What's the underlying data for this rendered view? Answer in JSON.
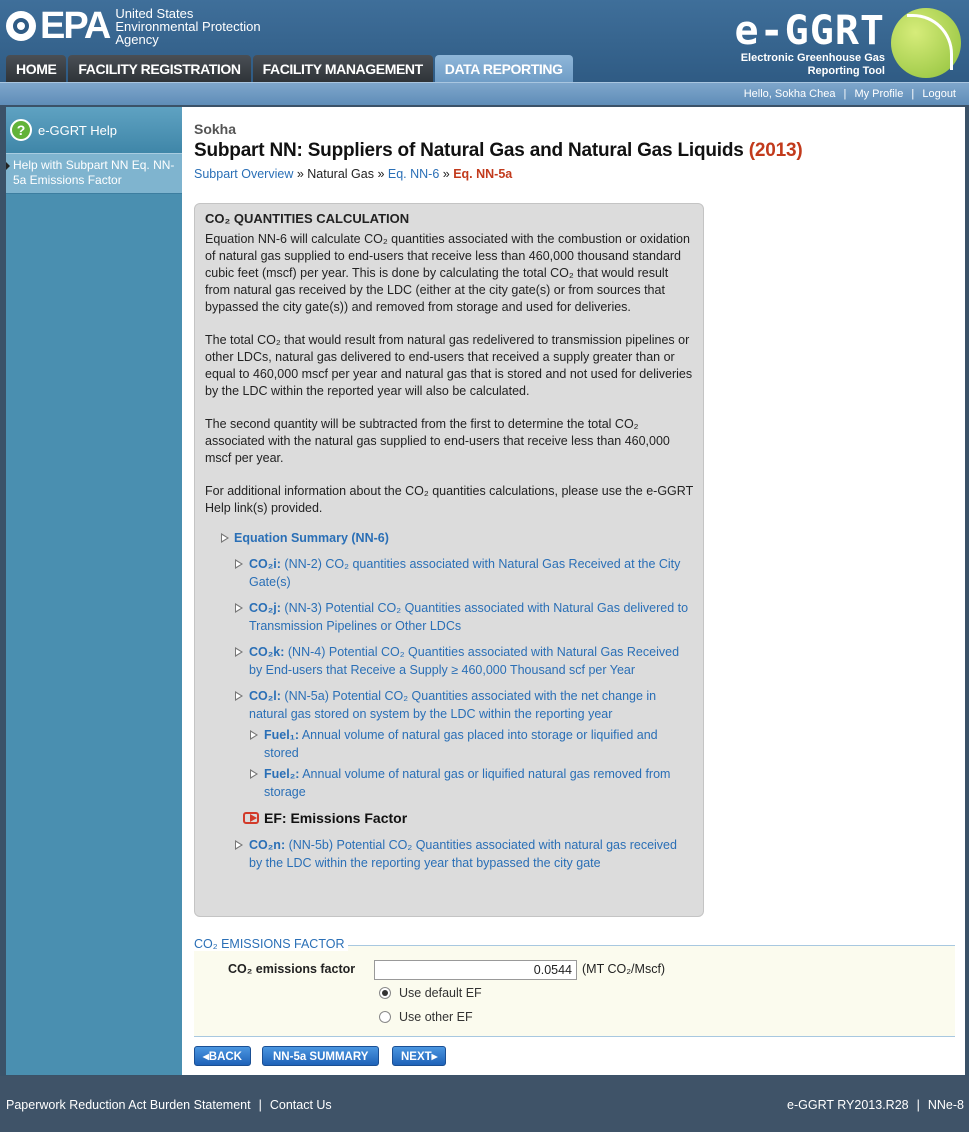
{
  "header": {
    "epa_word": "EPA",
    "epa_agency_line1": "United States",
    "epa_agency_line2": "Environmental Protection",
    "epa_agency_line3": "Agency",
    "ggrt_title": "e-GGRT",
    "ggrt_sub_line1": "Electronic Greenhouse Gas",
    "ggrt_sub_line2": "Reporting Tool"
  },
  "tabs": [
    {
      "label": "HOME"
    },
    {
      "label": "FACILITY REGISTRATION"
    },
    {
      "label": "FACILITY MANAGEMENT"
    },
    {
      "label": "DATA REPORTING"
    }
  ],
  "userbar": {
    "greeting": "Hello, Sokha Chea",
    "profile": "My Profile",
    "logout": "Logout",
    "sep": "|"
  },
  "leftnav": {
    "help_title": "e-GGRT Help",
    "help_icon": "?",
    "items": [
      {
        "label": "Help with Subpart NN Eq. NN-5a Emissions Factor"
      }
    ]
  },
  "main": {
    "org": "Sokha",
    "title": "Subpart NN: Suppliers of Natural Gas and Natural Gas Liquids",
    "year": "(2013)",
    "breadcrumb": {
      "overview": "Subpart Overview",
      "sep1": " » ",
      "natural_gas": "Natural Gas",
      "sep2": " » ",
      "eq_nn6": "Eq. NN-6",
      "sep3": " » ",
      "eq_nn5a": "Eq. NN-5a"
    },
    "calc": {
      "title": "CO₂ QUANTITIES CALCULATION",
      "paragraphs": [
        "Equation NN-6 will calculate CO₂ quantities associated with the combustion or oxidation of natural gas supplied to end-users that receive less than 460,000 thousand standard cubic feet (mscf) per year. This is done by calculating the total CO₂ that would result from natural gas received by the LDC (either at the city gate(s) or from sources that bypassed the city gate(s)) and removed from storage and used for deliveries.",
        "The total CO₂ that would result from natural gas redelivered to transmission pipelines or other LDCs, natural gas delivered to end-users that received a supply greater than or equal to 460,000 mscf per year and natural gas that is stored and not used for deliveries by the LDC within the reported year will also be calculated.",
        "The second quantity will be subtracted from the first to determine the total CO₂ associated with the natural gas supplied to end-users that receive less than 460,000 mscf per year.",
        "For additional information about the CO₂ quantities calculations, please use the e-GGRT Help link(s) provided."
      ],
      "tree": {
        "summary": "Equation Summary (NN-6)",
        "co2i_code": "CO₂i:",
        "co2i_text": " (NN-2) CO₂ quantities associated with Natural Gas Received at the City Gate(s)",
        "co2j_code": "CO₂j:",
        "co2j_text": " (NN-3) Potential CO₂ Quantities associated with Natural Gas delivered to Transmission Pipelines or Other LDCs",
        "co2k_code": "CO₂k:",
        "co2k_text": " (NN-4) Potential CO₂ Quantities associated with Natural Gas Received by End-users that Receive a Supply ≥ 460,000 Thousand scf per Year",
        "co2l_code": "CO₂l:",
        "co2l_text": " (NN-5a) Potential CO₂ Quantities associated with the net change in natural gas stored on system by the LDC within the reporting year",
        "fuel1_code": "Fuel₁:",
        "fuel1_text": " Annual volume of natural gas placed into storage or liquified and stored",
        "fuel2_code": "Fuel₂:",
        "fuel2_text": " Annual volume of natural gas or liquified natural gas removed from storage",
        "ef_current": "EF: Emissions Factor",
        "co2n_code": "CO₂n:",
        "co2n_text": " (NN-5b) Potential CO₂ Quantities associated with natural gas received by the LDC within the reporting year that bypassed the city gate"
      }
    },
    "ef_section": {
      "legend": "CO₂ EMISSIONS FACTOR",
      "label": "CO₂ emissions factor",
      "value": "0.0544",
      "unit": "(MT CO₂/Mscf)",
      "option_default": "Use default EF",
      "option_other": "Use other EF",
      "selected": "default"
    },
    "buttons": {
      "back": "◂BACK",
      "summary": "NN-5a SUMMARY",
      "next": "NEXT▸"
    }
  },
  "footer": {
    "paperwork": "Paperwork Reduction Act Burden Statement",
    "contact": "Contact Us",
    "sep": "|",
    "version": "e-GGRT RY2013.R28",
    "page_code": "NNe-8"
  },
  "colors": {
    "accent_blue": "#2a6fb6",
    "year_red": "#c23a1c",
    "nav_blue": "#4a8fb0",
    "button_blue": "#1e62b8"
  }
}
